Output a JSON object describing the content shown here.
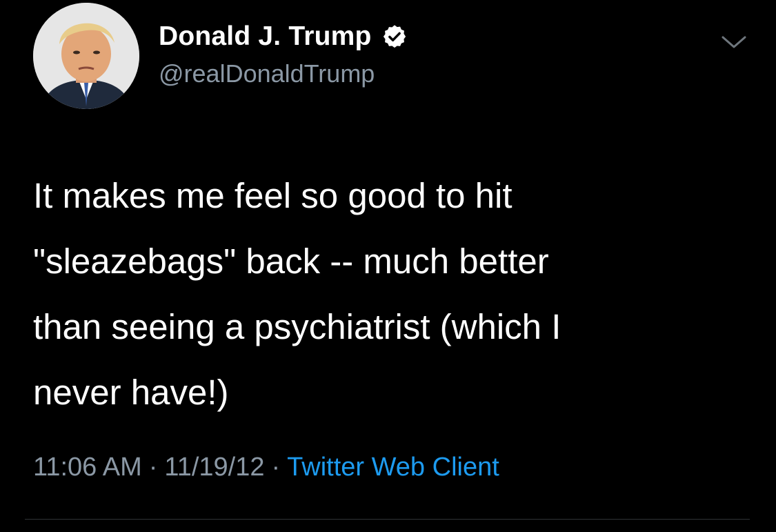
{
  "author": {
    "display_name": "Donald J. Trump",
    "handle": "@realDonaldTrump",
    "verified": true,
    "verified_icon": "verified-badge-icon"
  },
  "tweet": {
    "text": "It makes me feel so good to hit\n\"sleazebags\" back -- much better\nthan seeing a psychiatrist (which I\nnever have!)",
    "time": "11:06 AM",
    "date": "11/19/12",
    "separator": "·",
    "source": "Twitter Web Client"
  },
  "menu": {
    "icon": "chevron-down-icon"
  },
  "colors": {
    "background": "#000000",
    "text_primary": "#ffffff",
    "text_secondary": "#8b98a5",
    "link": "#1d9bf0",
    "divider": "#2f3336"
  }
}
